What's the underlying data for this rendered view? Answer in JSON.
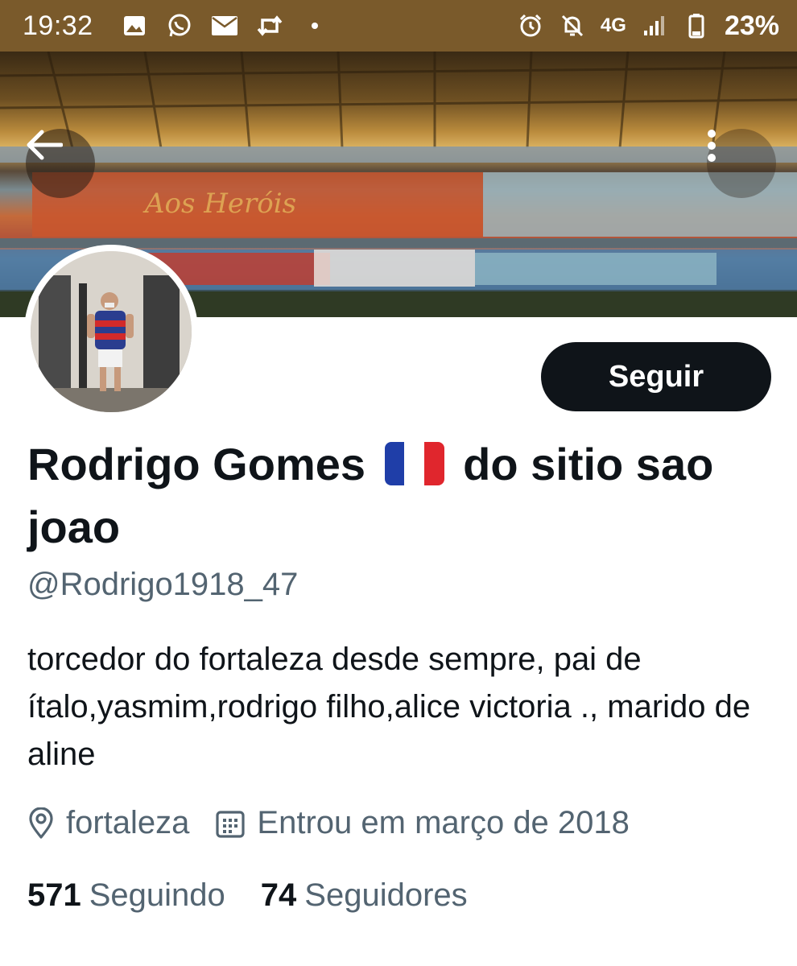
{
  "status_bar": {
    "time": "19:32",
    "network": "4G",
    "battery": "23%",
    "left_icons": [
      "image-icon",
      "whatsapp-icon",
      "mail-icon",
      "retweet-icon",
      "dot-icon"
    ],
    "right_icons": [
      "alarm-icon",
      "notifications-off-icon",
      "signal-icon",
      "battery-icon"
    ]
  },
  "profile": {
    "display_name_part1": "Rodrigo Gomes",
    "display_name_part2": "do sitio sao joao",
    "flag_emoji": "🇫🇷",
    "handle": "@Rodrigo1918_47",
    "bio": "torcedor do fortaleza desde sempre, pai de ítalo,yasmim,rodrigo filho,alice victoria ., marido de aline",
    "location": "fortaleza",
    "joined": "Entrou em março de 2018",
    "following_count": "571",
    "following_label": "Seguindo",
    "followers_count": "74",
    "followers_label": "Seguidores"
  },
  "actions": {
    "follow_label": "Seguir",
    "back_icon": "arrow-left-icon",
    "more_icon": "more-vertical-icon"
  },
  "colors": {
    "status_bar": "#7a5a2b",
    "primary_text": "#0f1419",
    "secondary_text": "#536471",
    "button_bg": "#0f1419",
    "flag_blue": "#1f3ea8",
    "flag_red": "#e0262d"
  }
}
